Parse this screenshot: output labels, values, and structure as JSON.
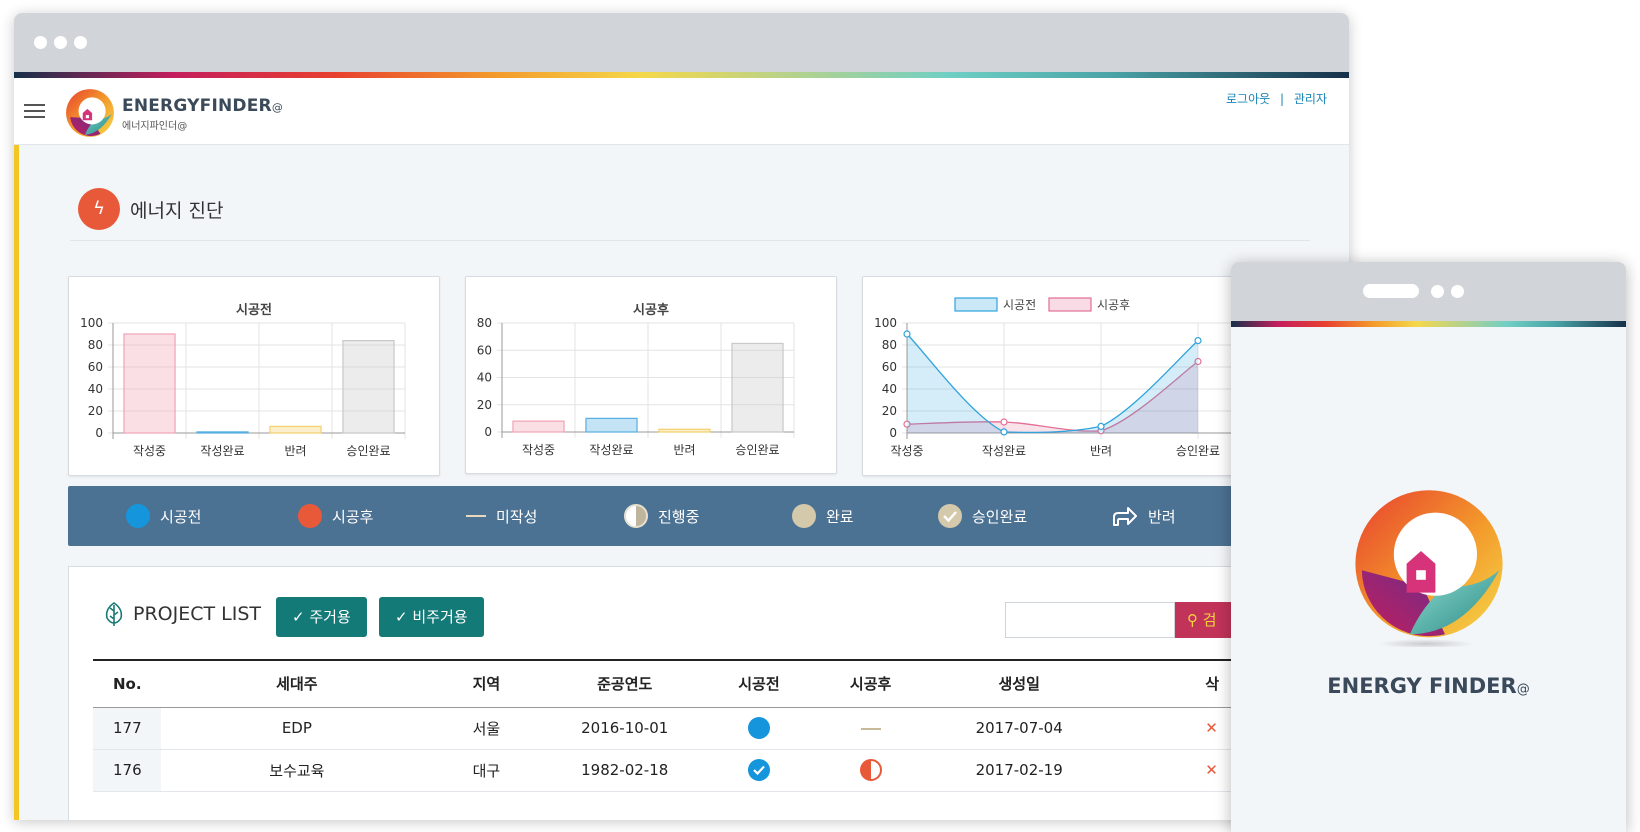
{
  "app": {
    "name": "ENERGYFINDER",
    "name_at": "@",
    "subname": "에너지파인더@"
  },
  "top_links": {
    "logout": "로그아웃",
    "separator": "|",
    "admin": "관리자"
  },
  "page": {
    "title": "에너지 진단"
  },
  "charts": {
    "before_title": "시공전",
    "after_title": "시공후",
    "legend_before": "시공전",
    "legend_after": "시공후"
  },
  "chart_data": [
    {
      "type": "bar",
      "title": "시공전",
      "categories": [
        "작성중",
        "작성완료",
        "반려",
        "승인완료"
      ],
      "values": [
        90,
        1,
        6,
        84
      ],
      "colors": [
        "#f0a3b5",
        "#56aee0",
        "#f3d06b",
        "#c9c9c9"
      ],
      "ylim": [
        0,
        100
      ],
      "yticks": [
        0,
        20,
        40,
        60,
        80,
        100
      ]
    },
    {
      "type": "bar",
      "title": "시공후",
      "categories": [
        "작성중",
        "작성완료",
        "반려",
        "승인완료"
      ],
      "values": [
        8,
        10,
        2,
        65
      ],
      "colors": [
        "#f0a3b5",
        "#56aee0",
        "#f3d06b",
        "#c9c9c9"
      ],
      "ylim": [
        0,
        80
      ],
      "yticks": [
        0,
        20,
        40,
        60,
        80
      ]
    },
    {
      "type": "area",
      "categories": [
        "작성중",
        "작성완료",
        "반려",
        "승인완료"
      ],
      "series": [
        {
          "name": "시공전",
          "values": [
            90,
            1,
            6,
            84
          ],
          "color": "#2fa3dc"
        },
        {
          "name": "시공후",
          "values": [
            8,
            10,
            2,
            65
          ],
          "color": "#e36f94"
        }
      ],
      "ylim": [
        0,
        100
      ],
      "yticks": [
        0,
        20,
        40,
        60,
        80,
        100
      ],
      "legend": "top-center"
    }
  ],
  "status_legend": [
    {
      "label": "시공전",
      "icon": "blue-circle-icon"
    },
    {
      "label": "시공후",
      "icon": "orange-circle-icon"
    },
    {
      "label": "미작성",
      "icon": "dash-icon"
    },
    {
      "label": "진행중",
      "icon": "half-circle-icon"
    },
    {
      "label": "완료",
      "icon": "beige-circle-icon"
    },
    {
      "label": "승인완료",
      "icon": "check-circle-icon"
    },
    {
      "label": "반려",
      "icon": "arrow-right-icon"
    }
  ],
  "project_list": {
    "title": "PROJECT LIST",
    "filters": [
      "주거용",
      "비주거용"
    ],
    "search_label": "검",
    "columns": [
      "No.",
      "세대주",
      "지역",
      "준공연도",
      "시공전",
      "시공후",
      "생성일",
      "삭"
    ],
    "rows": [
      {
        "no": "177",
        "owner": "EDP",
        "region": "서울",
        "year": "2016-10-01",
        "before": "blue-circle-icon",
        "after": "dash-icon",
        "created": "2017-07-04"
      },
      {
        "no": "176",
        "owner": "보수교육",
        "region": "대구",
        "year": "1982-02-18",
        "before": "check-circle-icon",
        "after": "half-circle-icon",
        "created": "2017-02-19"
      }
    ]
  },
  "mobile": {
    "brand": "ENERGY FINDER",
    "brand_at": "@"
  },
  "colors": {
    "accent": "#137a78",
    "legend_bg": "#4c7293",
    "danger": "#c2335a",
    "orange": "#e8593a",
    "blue": "#1595dc"
  }
}
